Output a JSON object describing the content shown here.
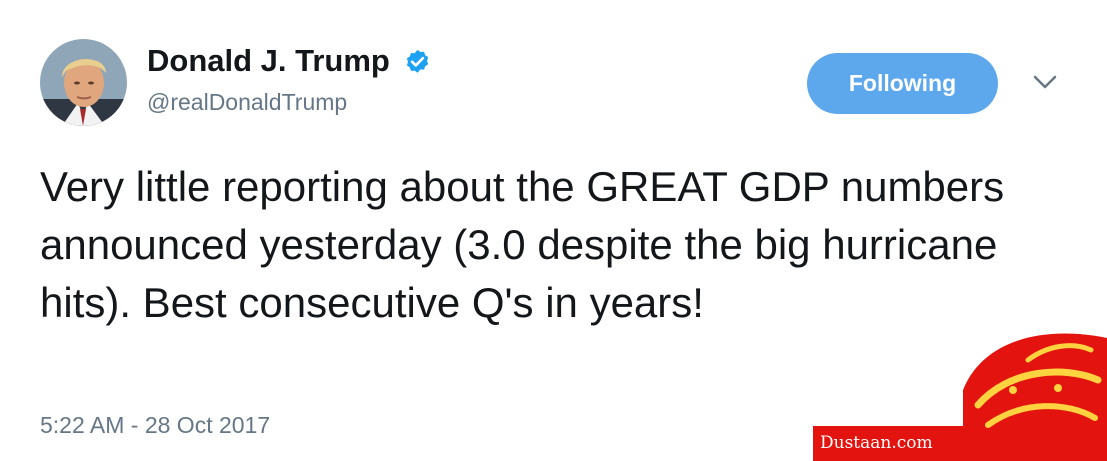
{
  "author": {
    "name": "Donald J. Trump",
    "handle": "@realDonaldTrump",
    "verified_icon": "verified-check-badge",
    "avatar_icon": "profile-photo"
  },
  "actions": {
    "follow_label": "Following",
    "more_icon": "chevron-down-icon"
  },
  "tweet": {
    "text": "Very little reporting about the GREAT GDP numbers announced yesterday (3.0 despite the big hurricane hits). Best consecutive Q's in years!",
    "timestamp": "5:22 AM - 28 Oct 2017"
  },
  "watermark": {
    "site": "Dustaan.com"
  },
  "colors": {
    "accent": "#5da8ec",
    "verified": "#1da1f2",
    "text": "#14171a",
    "muted": "#657786",
    "watermark_red": "#e3140f"
  }
}
